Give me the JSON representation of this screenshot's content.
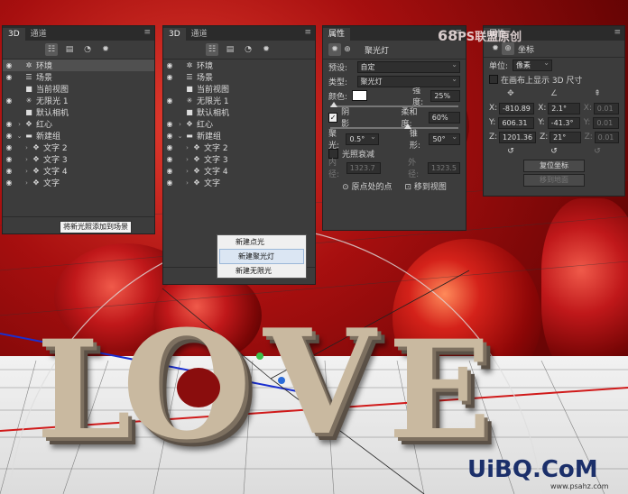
{
  "panel_3d_left": {
    "tabs": [
      "3D",
      "通道"
    ],
    "rows": [
      {
        "label": "环境",
        "icon": "environment-icon",
        "selected": true
      },
      {
        "label": "场景",
        "icon": "scene-icon"
      },
      {
        "label": "当前视图",
        "icon": "camera-icon"
      },
      {
        "label": "无限光 1",
        "icon": "light-icon"
      },
      {
        "label": "默认相机",
        "icon": "camera-icon"
      },
      {
        "label": "红心",
        "icon": "mesh-icon"
      },
      {
        "label": "新建组",
        "icon": "folder-icon"
      },
      {
        "label": "文字 2",
        "icon": "mesh-icon"
      },
      {
        "label": "文字 3",
        "icon": "mesh-icon"
      },
      {
        "label": "文字 4",
        "icon": "mesh-icon"
      },
      {
        "label": "文字",
        "icon": "mesh-icon"
      }
    ],
    "tooltip": "将新光照添加到场景"
  },
  "panel_3d_right": {
    "tabs": [
      "3D",
      "通道"
    ],
    "rows": [
      {
        "label": "环境"
      },
      {
        "label": "场景"
      },
      {
        "label": "当前视图"
      },
      {
        "label": "无限光 1"
      },
      {
        "label": "默认相机"
      },
      {
        "label": "红心"
      },
      {
        "label": "新建组"
      },
      {
        "label": "文字 2"
      },
      {
        "label": "文字 3"
      },
      {
        "label": "文字 4"
      },
      {
        "label": "文字"
      }
    ],
    "menu": [
      "新建点光",
      "新建聚光灯",
      "新建无限光"
    ]
  },
  "properties_panel": {
    "tab": "属性",
    "title": "聚光灯",
    "preset_label": "预设:",
    "preset_value": "自定",
    "type_label": "类型:",
    "type_value": "聚光灯",
    "color_label": "颜色:",
    "intensity_label": "强度:",
    "intensity_value": "25%",
    "shadow_label": "阴影",
    "softness_label": "柔和度:",
    "softness_value": "60%",
    "hotspot_label": "聚光:",
    "hotspot_value": "0.5°",
    "cone_label": "锥形:",
    "cone_value": "50°",
    "falloff_label": "光照衰减",
    "inner_label": "内径:",
    "inner_value": "1323.7",
    "outer_label": "外径:",
    "outer_value": "1323.5",
    "origin_btn": "原点处的点",
    "move_btn": "移到视图"
  },
  "coordinates_panel": {
    "tab": "属性",
    "title": "坐标",
    "unit_label": "单位:",
    "unit_value": "像素",
    "show_size": "在画布上显示 3D 尺寸",
    "x_label": "X:",
    "y_label": "Y:",
    "z_label": "Z:",
    "x_pos": "-810.89",
    "y_pos": "606.31",
    "z_pos": "1201.36",
    "x_rot": "2.1°",
    "y_rot": "-41.3°",
    "z_rot": "21°",
    "x_scale": "0.01",
    "y_scale": "0.01",
    "z_scale": "0.01",
    "reset_btn": "复位坐标",
    "move_btn": "移到地面"
  },
  "watermark_top": {
    "text": "PS联盟原创",
    "num": "68"
  },
  "watermark_bottom": {
    "text": "UiBQ.CoM",
    "sub": "www.psahz.com"
  },
  "scene_text": [
    "L",
    "O",
    "V",
    "E"
  ]
}
